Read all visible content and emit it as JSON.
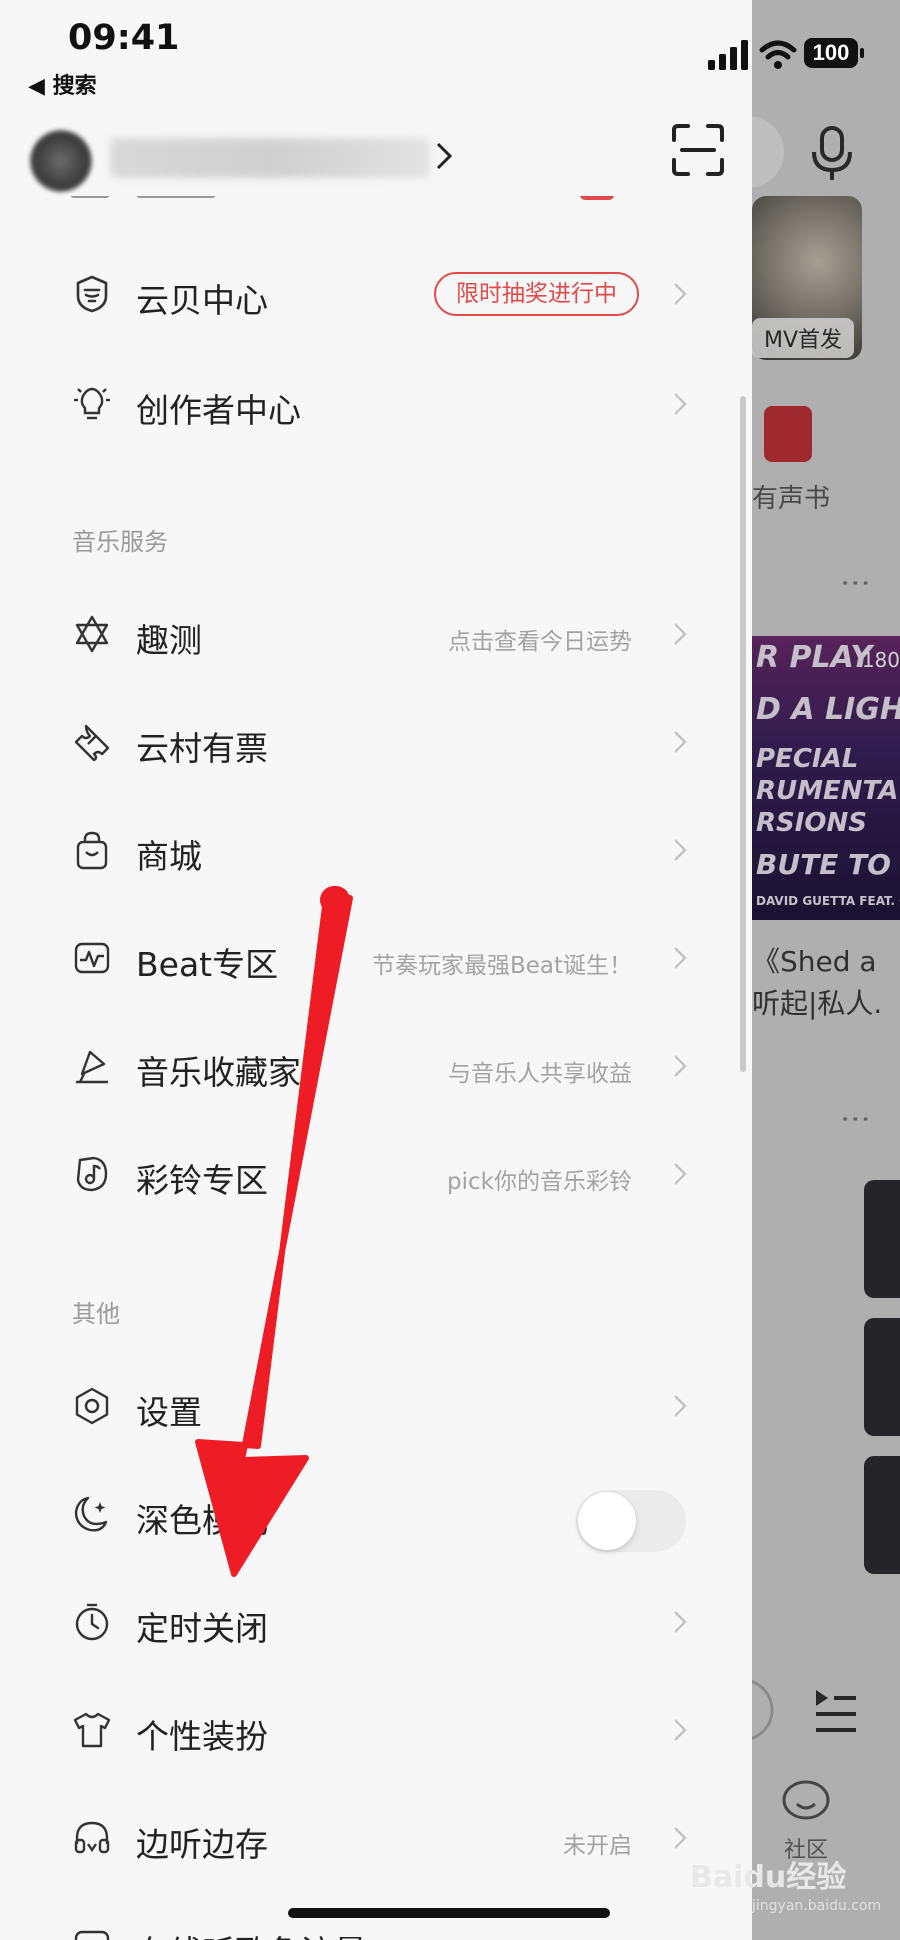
{
  "status_bar": {
    "time": "09:41",
    "back_link": "◀ 搜索",
    "battery": "100"
  },
  "background_app": {
    "mv_tag": "MV首发",
    "book_label": "有声书",
    "album_lines": [
      "R PLAY",
      "D A LIGH",
      "PECIAL",
      "RUMENTA",
      "RSIONS",
      "BUTE TO",
      "DAVID GUETTA FEAT. CHEAT"
    ],
    "album_badge": "180",
    "song_title_line1": "《Shed a",
    "song_title_line2": "听起|私人.",
    "tab_community": "社区"
  },
  "drawer": {
    "sections": {
      "music_services": "音乐服务",
      "other": "其他"
    },
    "items_top": [
      {
        "label": "云贝中心",
        "badge": "限时抽奖进行中",
        "icon": "cloud-bei-icon"
      },
      {
        "label": "创作者中心",
        "icon": "bulb-icon"
      }
    ],
    "items_music": [
      {
        "label": "趣测",
        "sub": "点击查看今日运势",
        "icon": "star-of-david-icon"
      },
      {
        "label": "云村有票",
        "sub": "",
        "icon": "ticket-icon"
      },
      {
        "label": "商城",
        "sub": "",
        "icon": "shopping-bag-icon"
      },
      {
        "label": "Beat专区",
        "sub": "节奏玩家最强Beat诞生！",
        "icon": "waveform-icon"
      },
      {
        "label": "音乐收藏家",
        "sub": "与音乐人共享收益",
        "icon": "collector-icon"
      },
      {
        "label": "彩铃专区",
        "sub": "pick你的音乐彩铃",
        "icon": "ringtone-icon"
      }
    ],
    "items_other": [
      {
        "label": "设置",
        "sub": "",
        "icon": "settings-hex-icon"
      },
      {
        "label": "深色模式",
        "sub": "",
        "icon": "moon-icon",
        "toggle": false
      },
      {
        "label": "定时关闭",
        "sub": "",
        "icon": "timer-icon"
      },
      {
        "label": "个性装扮",
        "sub": "",
        "icon": "tshirt-icon"
      },
      {
        "label": "边听边存",
        "sub": "未开启",
        "icon": "headphones-icon"
      }
    ],
    "partial_bottom_label": "在线听歌免流量"
  },
  "colors": {
    "accent_red": "#e24a4a",
    "annotation_arrow": "#ee1c25"
  },
  "watermark": {
    "text": "Baidu经验",
    "sub": "jingyan.baidu.com"
  }
}
